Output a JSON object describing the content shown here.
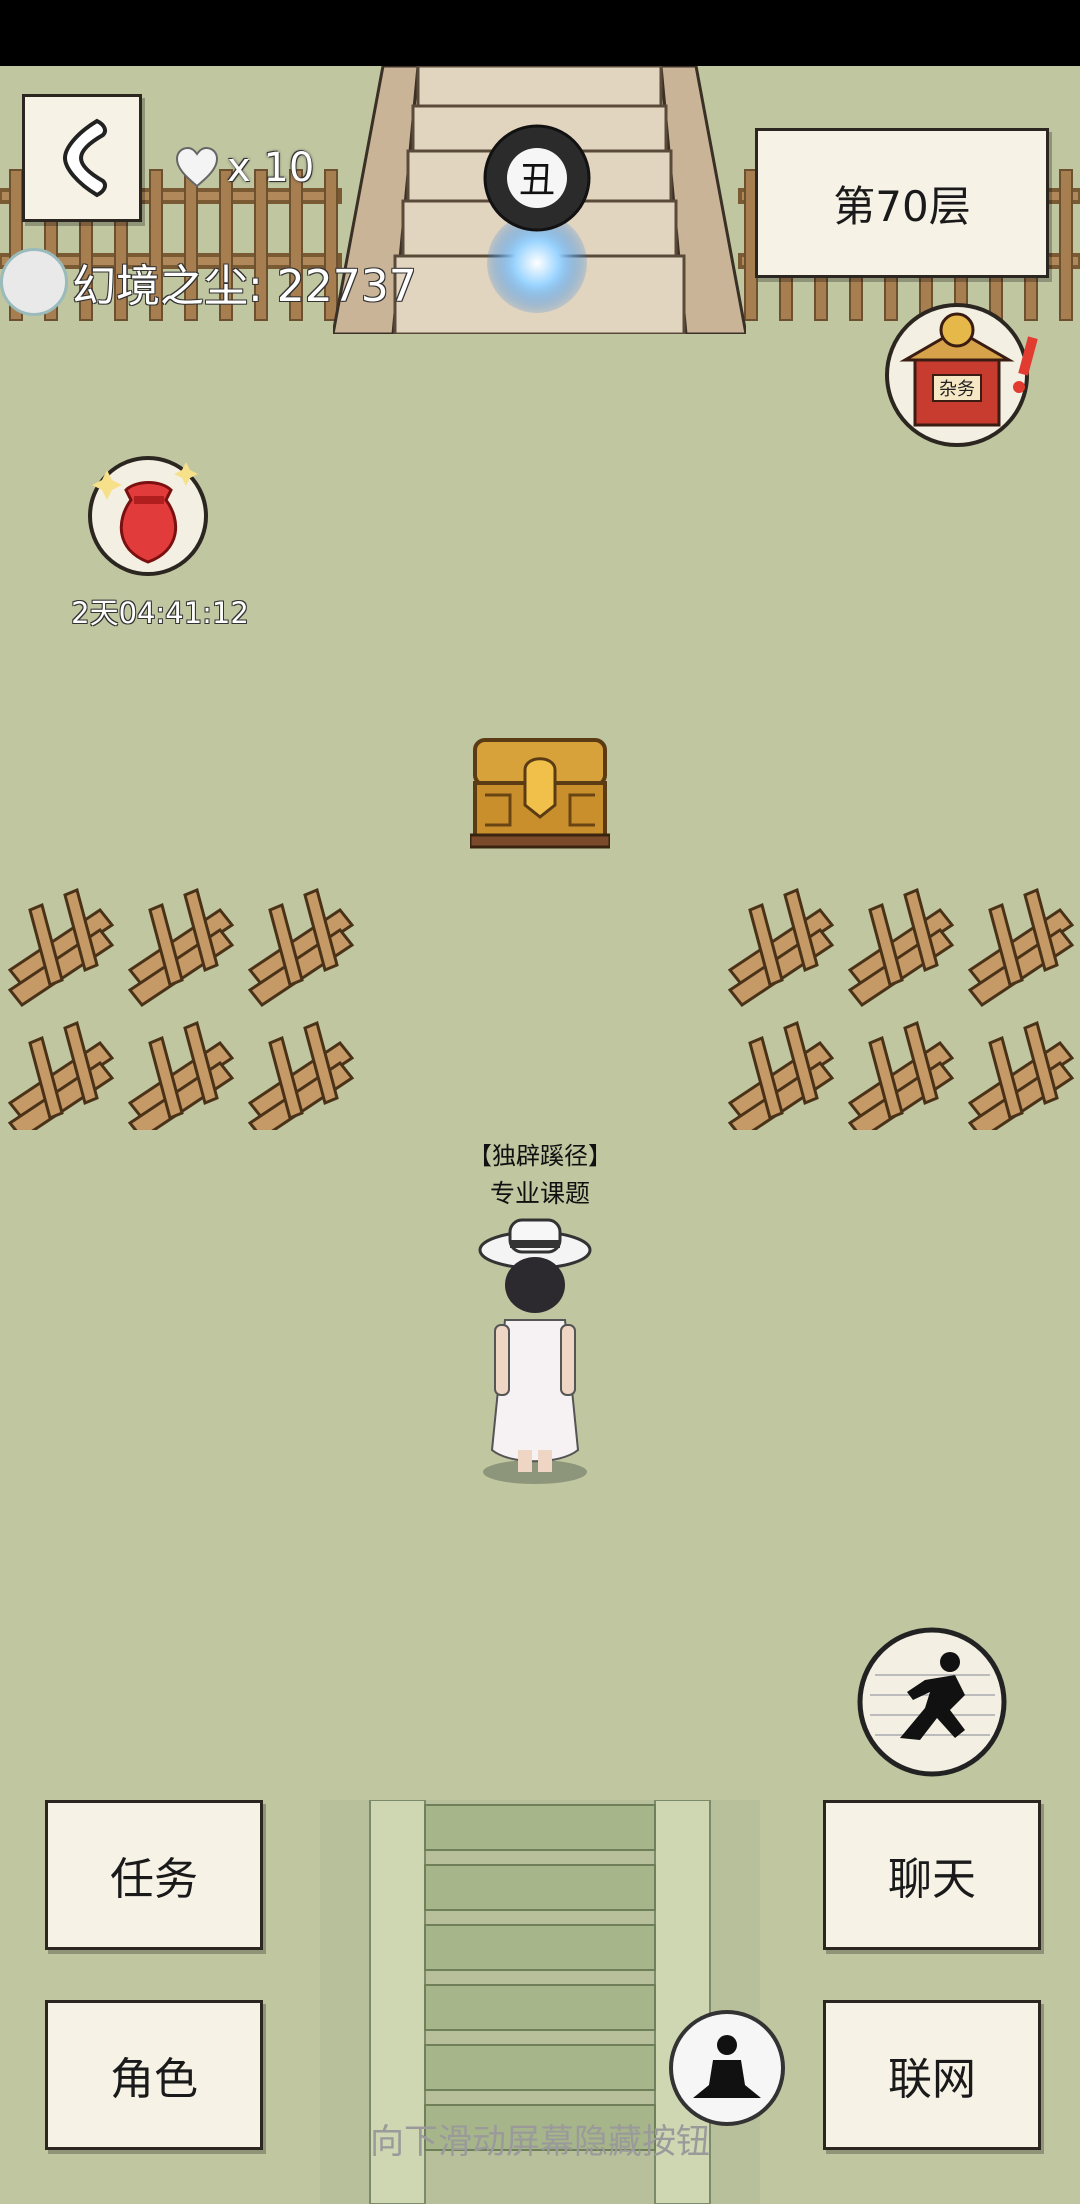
{
  "header": {
    "lives_count": "x 10",
    "dust_label": "幻境之尘: 22737",
    "floor_label": "第70层",
    "portal_symbol": "丑"
  },
  "shop": {
    "sign_text": "杂务"
  },
  "bag": {
    "timer": "2天04:41:12"
  },
  "player": {
    "name": "【独辟蹊径】",
    "title": "专业课题"
  },
  "buttons": {
    "task": "任务",
    "role": "角色",
    "chat": "聊天",
    "network": "联网"
  },
  "hint": "向下滑动屏幕隐藏按钮",
  "colors": {
    "ground": "#bfc6a0",
    "paper": "#f6f2e6",
    "wood": "#b0885a",
    "portal_glow": "#7cc4ff"
  }
}
